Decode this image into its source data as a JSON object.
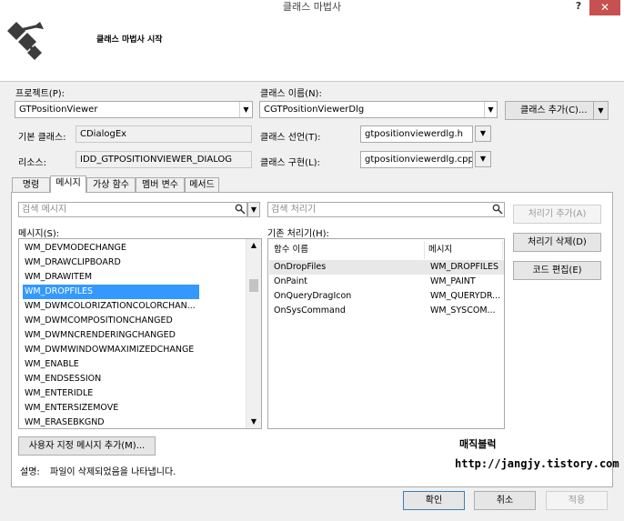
{
  "window": {
    "title": "클래스 마법사",
    "help": "?",
    "close": "✕"
  },
  "header": {
    "title": "클래스 마법사 시작"
  },
  "project": {
    "label": "프로젝트(P):",
    "value": "GTPositionViewer"
  },
  "class_name": {
    "label": "클래스 이름(N):",
    "value": "CGTPositionViewerDlg"
  },
  "add_class_button": "클래스 추가(C)...",
  "base_class": {
    "label": "기본 클래스:",
    "value": "CDialogEx"
  },
  "class_declaration": {
    "label": "클래스 선언(T):",
    "value": "gtpositionviewerdlg.h"
  },
  "resource": {
    "label": "리소스:",
    "value": "IDD_GTPOSITIONVIEWER_DIALOG"
  },
  "class_implementation": {
    "label": "클래스 구현(L):",
    "value": "gtpositionviewerdlg.cpp"
  },
  "tabs": [
    "명령",
    "메시지",
    "가상 함수",
    "멤버 변수",
    "메서드"
  ],
  "search_messages": {
    "placeholder": "검색 메시지"
  },
  "search_handlers": {
    "placeholder": "검색 처리기"
  },
  "messages_label": "메시지(S):",
  "messages": [
    "WM_DEVMODECHANGE",
    "WM_DRAWCLIPBOARD",
    "WM_DRAWITEM",
    "WM_DROPFILES",
    "WM_DWMCOLORIZATIONCOLORCHAN...",
    "WM_DWMCOMPOSITIONCHANGED",
    "WM_DWMNCRENDERINGCHANGED",
    "WM_DWMWINDOWMAXIMIZEDCHANGE",
    "WM_ENABLE",
    "WM_ENDSESSION",
    "WM_ENTERIDLE",
    "WM_ENTERSIZEMOVE",
    "WM_ERASEBKGND"
  ],
  "selected_message": "WM_DROPFILES",
  "handlers_label": "기존 처리기(H):",
  "handler_columns": [
    "함수 이름",
    "메시지"
  ],
  "handlers": [
    {
      "function": "OnDropFiles",
      "message": "WM_DROPFILES"
    },
    {
      "function": "OnPaint",
      "message": "WM_PAINT"
    },
    {
      "function": "OnQueryDragIcon",
      "message": "WM_QUERYDR..."
    },
    {
      "function": "OnSysCommand",
      "message": "WM_SYSCOM..."
    }
  ],
  "buttons": {
    "add_handler": "처리기 추가(A)",
    "delete_handler": "처리기 삭제(D)",
    "edit_code": "코드 편집(E)",
    "add_custom_message": "사용자 지정 메시지 추가(M)...",
    "ok": "확인",
    "cancel": "취소",
    "apply": "적용"
  },
  "description": {
    "label": "설명:",
    "text": "파일이 삭제되었음을 나타냅니다."
  },
  "watermark": {
    "name": "매직블럭",
    "url": "http://jangjy.tistory.com"
  },
  "colors": {
    "selection": "#3399ff",
    "close_button": "#c75050"
  }
}
